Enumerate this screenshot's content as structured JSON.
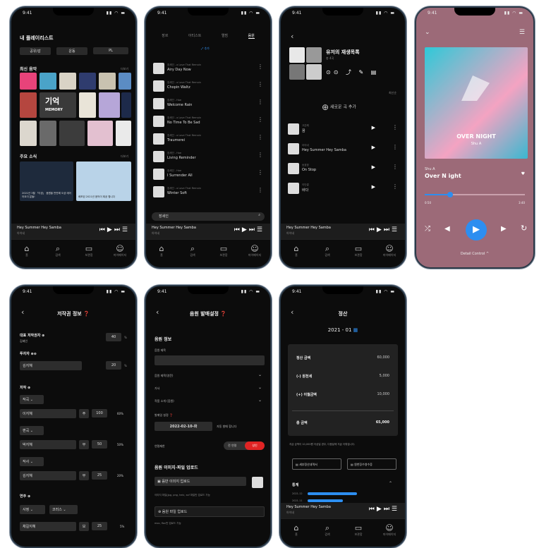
{
  "status_time": "9:41",
  "tabs": [
    "홈",
    "검색",
    "보관함",
    "마이페이지"
  ],
  "p1": {
    "title": "내 플레이리스트",
    "chips": [
      "공유/감",
      "운동",
      "PL"
    ],
    "recent": "최신 음악",
    "more": "더보기",
    "album_text": "기억",
    "memory": "MEMORY",
    "news": "주요 소식",
    "news_more": "더보기",
    "news1": "2021년 3월 「이경」 음원을 만반해 오셨 태어 어요이 분들!",
    "news2": "배포된 2021년 음악이 제공 합니다",
    "mini_song": "Hey Summer Hey Samba",
    "mini_artist": "아이네"
  },
  "p2": {
    "tabs": [
      "장르",
      "아티스트",
      "앨범",
      "음원"
    ],
    "add": "추가",
    "tracks": [
      {
        "artist": "장세인 - a Love That Remain",
        "title": "Airy Day Now"
      },
      {
        "artist": "장세인 - a Love That Remain",
        "title": "Chopin Waltz"
      },
      {
        "artist": "장세인 - Hoe",
        "title": "Welcome Rain"
      },
      {
        "artist": "장세인 - a Love That Remain",
        "title": "No Time To Be Sad"
      },
      {
        "artist": "장세인 - a Love That Remain",
        "title": "Traumerei"
      },
      {
        "artist": "장세인 - Hoe",
        "title": "Living Reminder"
      },
      {
        "artist": "장세인 - Hoe",
        "title": "I Surrender All"
      },
      {
        "artist": "장세인 - a Love That Remain",
        "title": "Winter Soft"
      }
    ],
    "search": "장세인",
    "mini_song": "Hey Summer Hey Samba",
    "mini_artist": "아이네"
  },
  "p3": {
    "title": "유저의 재생목록",
    "count": "총 4곡",
    "sort": "최신순",
    "add": "새로운 곡 추가",
    "tracks": [
      {
        "artist": "고은해",
        "title": "꿈"
      },
      {
        "artist": "아이네",
        "title": "Hey Summer Hey Samba"
      },
      {
        "artist": "송효정",
        "title": "On Stop"
      },
      {
        "artist": "이단결",
        "title": "바다"
      }
    ],
    "mini_song": "Hey Summer Hey Samba",
    "mini_artist": "아이네"
  },
  "p4": {
    "cover_title": "OVER NIGHT",
    "cover_artist": "Shu A",
    "artist": "Shu A",
    "song": "Over N ight",
    "elapsed": "0:50",
    "total": "3:40",
    "progress": 0.25,
    "detail": "Detail Control ^"
  },
  "p5": {
    "title": "저작권 정보",
    "rep": "대표 저작권자",
    "rep_name": "김혜인",
    "rep_pct": "40",
    "investor": "투자자",
    "inv_name": "김지혜",
    "inv_pct": "20",
    "creation": "저작",
    "rows": [
      {
        "role": "작곡",
        "name": "이지혜",
        "type": "주",
        "val": "100",
        "pct": "60%"
      },
      {
        "role": "편곡",
        "name": "박지혜",
        "type": "부",
        "val": "50",
        "pct": "50%"
      },
      {
        "role": "작사",
        "name": "김지혜",
        "type": "부",
        "val": "25",
        "pct": "20%"
      }
    ],
    "perform": "연주",
    "perf_role": "사정",
    "perf_role2": "코러스",
    "perf_name": "채길지혜",
    "perf_type": "보",
    "perf_val": "25",
    "perf_pct": "5%",
    "pct_unit": "%"
  },
  "p6": {
    "title": "음원 발매설정",
    "info": "음원 정보",
    "song_title": "음원 제목",
    "song_title_en": "음원 제목(영문)",
    "lyrics": "가사",
    "intro": "작품 소개 (음원)",
    "release": "발매일 설정",
    "date": "2022-02-10-화",
    "date_note": "자동 발매 합니다",
    "age": "연령제한",
    "age_all": "전 연령",
    "age_adult": "성인",
    "upload": "음원 이미지·파일 업로드",
    "cover_upload": "음반 이미지 업로드",
    "cover_note": "이미지 파일(jpg, png, heic, svf 파일만 업로드 가능",
    "file_upload": "음원 파일 업로드",
    "file_note": "mov, flac만 업로드 가능"
  },
  "p7": {
    "title": "정산",
    "period": "2021 - 01",
    "rows": [
      {
        "label": "정산 금액",
        "value": "60,000"
      },
      {
        "label": "(-) 원천세",
        "value": "5,000"
      },
      {
        "label": "(+) 이월금액",
        "value": "10,000"
      }
    ],
    "total_label": "총 금액",
    "total_value": "65,000",
    "note": "지급 금액이 10,000원 이상일 경우, 다음달에 지급 이뤄집니다.",
    "btn1": "세부정산내역서",
    "btn2": "원천징수영수증",
    "stats": "통계",
    "stat_rows": [
      "2021-12",
      "2021-11"
    ],
    "mini_song": "Hey Summer Hey Samba",
    "mini_artist": "아이네"
  }
}
